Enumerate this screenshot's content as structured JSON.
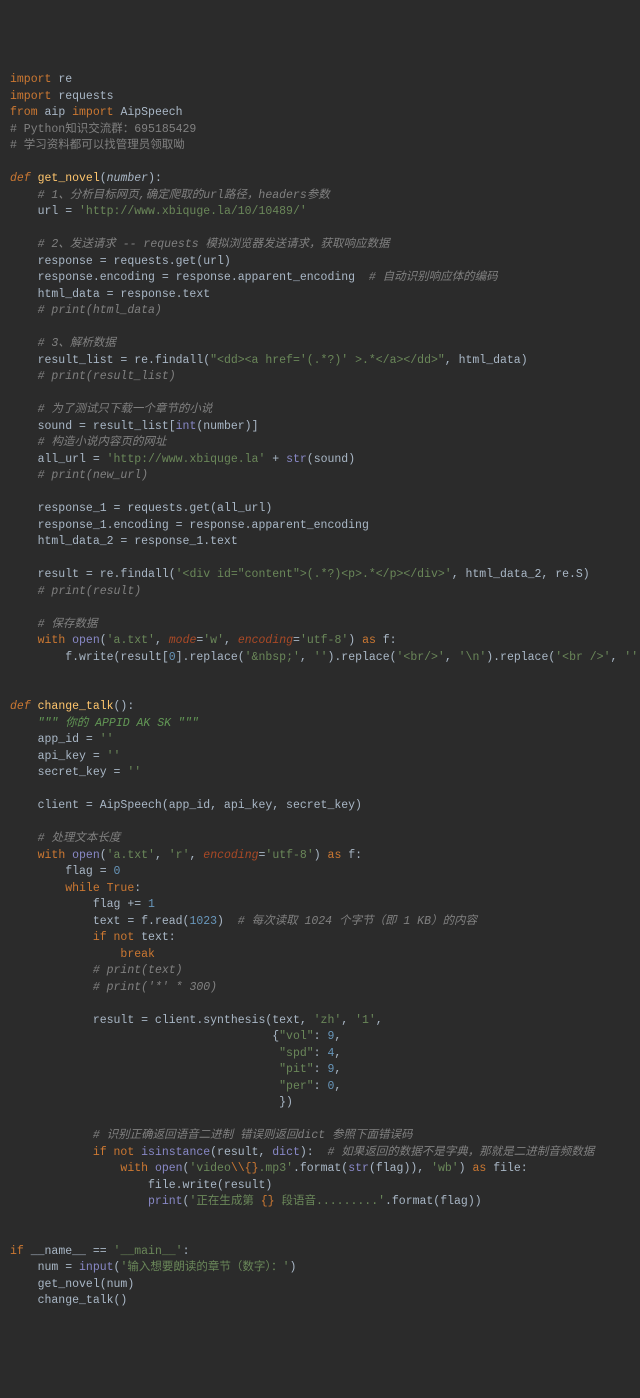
{
  "lines": [
    [
      [
        "kw",
        "import "
      ],
      [
        "op",
        "re"
      ]
    ],
    [
      [
        "kw",
        "import "
      ],
      [
        "op",
        "requests"
      ]
    ],
    [
      [
        "kw",
        "from "
      ],
      [
        "op",
        "aip "
      ],
      [
        "kw",
        "import "
      ],
      [
        "op",
        "AipSpeech"
      ]
    ],
    [
      [
        "cmt",
        "# Python知识交流群：695185429"
      ]
    ],
    [
      [
        "cmt",
        "# 学习资料都可以找管理员领取呦"
      ]
    ],
    [
      [
        "op",
        ""
      ]
    ],
    [
      [
        "kw kw-i",
        "def "
      ],
      [
        "fn",
        "get_novel"
      ],
      [
        "op",
        "("
      ],
      [
        "param",
        "number"
      ],
      [
        "op",
        "):"
      ]
    ],
    [
      [
        "op",
        "    "
      ],
      [
        "cmt cmt-i",
        "# 1、分析目标网页,确定爬取的url路径，headers参数"
      ]
    ],
    [
      [
        "op",
        "    url = "
      ],
      [
        "str",
        "'http://www.xbiquge.la/10/10489/'"
      ]
    ],
    [
      [
        "op",
        ""
      ]
    ],
    [
      [
        "op",
        "    "
      ],
      [
        "cmt cmt-i",
        "# 2、发送请求 -- requests 模拟浏览器发送请求，获取响应数据"
      ]
    ],
    [
      [
        "op",
        "    response = requests.get(url)"
      ]
    ],
    [
      [
        "op",
        "    response.encoding = response.apparent_encoding  "
      ],
      [
        "cmt cmt-i",
        "# 自动识别响应体的编码"
      ]
    ],
    [
      [
        "op",
        "    html_data = response.text"
      ]
    ],
    [
      [
        "op",
        "    "
      ],
      [
        "cmt cmt-i",
        "# print(html_data)"
      ]
    ],
    [
      [
        "op",
        ""
      ]
    ],
    [
      [
        "op",
        "    "
      ],
      [
        "cmt cmt-i",
        "# 3、解析数据"
      ]
    ],
    [
      [
        "op",
        "    result_list = re.findall("
      ],
      [
        "str",
        "\"<dd><a href='(.*?)' >.*</a></dd>\""
      ],
      [
        "op",
        ", html_data)"
      ]
    ],
    [
      [
        "op",
        "    "
      ],
      [
        "cmt cmt-i",
        "# print(result_list)"
      ]
    ],
    [
      [
        "op",
        ""
      ]
    ],
    [
      [
        "op",
        "    "
      ],
      [
        "cmt cmt-i",
        "# 为了测试只下载一个章节的小说"
      ]
    ],
    [
      [
        "op",
        "    sound = result_list["
      ],
      [
        "built",
        "int"
      ],
      [
        "op",
        "(number)]"
      ]
    ],
    [
      [
        "op",
        "    "
      ],
      [
        "cmt cmt-i",
        "# 构造小说内容页的网址"
      ]
    ],
    [
      [
        "op",
        "    all_url = "
      ],
      [
        "str",
        "'http://www.xbiquge.la'"
      ],
      [
        "op",
        " + "
      ],
      [
        "built",
        "str"
      ],
      [
        "op",
        "(sound)"
      ]
    ],
    [
      [
        "op",
        "    "
      ],
      [
        "cmt cmt-i",
        "# print(new_url)"
      ]
    ],
    [
      [
        "op",
        ""
      ]
    ],
    [
      [
        "op",
        "    response_1 = requests.get(all_url)"
      ]
    ],
    [
      [
        "op",
        "    response_1.encoding = response.apparent_encoding"
      ]
    ],
    [
      [
        "op",
        "    html_data_2 = response_1.text"
      ]
    ],
    [
      [
        "op",
        ""
      ]
    ],
    [
      [
        "op",
        "    result = re.findall("
      ],
      [
        "str",
        "'<div id=\"content\">(.*?)<p>.*</p></div>'"
      ],
      [
        "op",
        ", html_data_2, re.S)"
      ]
    ],
    [
      [
        "op",
        "    "
      ],
      [
        "cmt cmt-i",
        "# print(result)"
      ]
    ],
    [
      [
        "op",
        ""
      ]
    ],
    [
      [
        "op",
        "    "
      ],
      [
        "cmt cmt-i",
        "# 保存数据"
      ]
    ],
    [
      [
        "op",
        "    "
      ],
      [
        "kw",
        "with "
      ],
      [
        "built",
        "open"
      ],
      [
        "op",
        "("
      ],
      [
        "str",
        "'a.txt'"
      ],
      [
        "op",
        ", "
      ],
      [
        "named",
        "mode"
      ],
      [
        "op",
        "="
      ],
      [
        "str",
        "'w'"
      ],
      [
        "op",
        ", "
      ],
      [
        "named",
        "encoding"
      ],
      [
        "op",
        "="
      ],
      [
        "str",
        "'utf-8'"
      ],
      [
        "op",
        ") "
      ],
      [
        "kw",
        "as "
      ],
      [
        "op",
        "f:"
      ]
    ],
    [
      [
        "op",
        "        f.write(result["
      ],
      [
        "num",
        "0"
      ],
      [
        "op",
        "].replace("
      ],
      [
        "str",
        "'&nbsp;'"
      ],
      [
        "op",
        ", "
      ],
      [
        "str",
        "''"
      ],
      [
        "op",
        ").replace("
      ],
      [
        "str",
        "'<br/>'"
      ],
      [
        "op",
        ", "
      ],
      [
        "str",
        "'\\n'"
      ],
      [
        "op",
        ").replace("
      ],
      [
        "str",
        "'<br />'"
      ],
      [
        "op",
        ", "
      ],
      [
        "str",
        "''"
      ],
      [
        "op",
        "))"
      ]
    ],
    [
      [
        "op",
        ""
      ]
    ],
    [
      [
        "op",
        ""
      ]
    ],
    [
      [
        "kw kw-i",
        "def "
      ],
      [
        "fn",
        "change_talk"
      ],
      [
        "op",
        "():"
      ]
    ],
    [
      [
        "op",
        "    "
      ],
      [
        "doc",
        "\"\"\" 你的 APPID AK SK \"\"\""
      ]
    ],
    [
      [
        "op",
        "    app_id = "
      ],
      [
        "str",
        "''"
      ]
    ],
    [
      [
        "op",
        "    api_key = "
      ],
      [
        "str",
        "''"
      ]
    ],
    [
      [
        "op",
        "    secret_key = "
      ],
      [
        "str",
        "''"
      ]
    ],
    [
      [
        "op",
        ""
      ]
    ],
    [
      [
        "op",
        "    client = AipSpeech(app_id, api_key, secret_key)"
      ]
    ],
    [
      [
        "op",
        ""
      ]
    ],
    [
      [
        "op",
        "    "
      ],
      [
        "cmt cmt-i",
        "# 处理文本长度"
      ]
    ],
    [
      [
        "op",
        "    "
      ],
      [
        "kw",
        "with "
      ],
      [
        "built",
        "open"
      ],
      [
        "op",
        "("
      ],
      [
        "str",
        "'a.txt'"
      ],
      [
        "op",
        ", "
      ],
      [
        "str",
        "'r'"
      ],
      [
        "op",
        ", "
      ],
      [
        "named",
        "encoding"
      ],
      [
        "op",
        "="
      ],
      [
        "str",
        "'utf-8'"
      ],
      [
        "op",
        ") "
      ],
      [
        "kw",
        "as "
      ],
      [
        "op",
        "f:"
      ]
    ],
    [
      [
        "op",
        "        flag = "
      ],
      [
        "num",
        "0"
      ]
    ],
    [
      [
        "op",
        "        "
      ],
      [
        "kw",
        "while True"
      ],
      [
        "op",
        ":"
      ]
    ],
    [
      [
        "op",
        "            flag += "
      ],
      [
        "num",
        "1"
      ]
    ],
    [
      [
        "op",
        "            text = f.read("
      ],
      [
        "num",
        "1023"
      ],
      [
        "op",
        ")  "
      ],
      [
        "cmt cmt-i",
        "# 每次读取 1024 个字节（即 1 KB）的内容"
      ]
    ],
    [
      [
        "op",
        "            "
      ],
      [
        "kw",
        "if not "
      ],
      [
        "op",
        "text:"
      ]
    ],
    [
      [
        "op",
        "                "
      ],
      [
        "kw",
        "break"
      ]
    ],
    [
      [
        "op",
        "            "
      ],
      [
        "cmt cmt-i",
        "# print(text)"
      ]
    ],
    [
      [
        "op",
        "            "
      ],
      [
        "cmt cmt-i",
        "# print('*' * 300)"
      ]
    ],
    [
      [
        "op",
        ""
      ]
    ],
    [
      [
        "op",
        "            result = client.synthesis(text, "
      ],
      [
        "str",
        "'zh'"
      ],
      [
        "op",
        ", "
      ],
      [
        "str",
        "'1'"
      ],
      [
        "op",
        ","
      ]
    ],
    [
      [
        "op",
        "                                      {"
      ],
      [
        "str",
        "\"vol\""
      ],
      [
        "op",
        ": "
      ],
      [
        "num",
        "9"
      ],
      [
        "op",
        ","
      ]
    ],
    [
      [
        "op",
        "                                       "
      ],
      [
        "str",
        "\"spd\""
      ],
      [
        "op",
        ": "
      ],
      [
        "num",
        "4"
      ],
      [
        "op",
        ","
      ]
    ],
    [
      [
        "op",
        "                                       "
      ],
      [
        "str",
        "\"pit\""
      ],
      [
        "op",
        ": "
      ],
      [
        "num",
        "9"
      ],
      [
        "op",
        ","
      ]
    ],
    [
      [
        "op",
        "                                       "
      ],
      [
        "str",
        "\"per\""
      ],
      [
        "op",
        ": "
      ],
      [
        "num",
        "0"
      ],
      [
        "op",
        ","
      ]
    ],
    [
      [
        "op",
        "                                       })"
      ]
    ],
    [
      [
        "op",
        ""
      ]
    ],
    [
      [
        "op",
        "            "
      ],
      [
        "cmt cmt-i",
        "# 识别正确返回语音二进制 错误则返回dict 参照下面错误码"
      ]
    ],
    [
      [
        "op",
        "            "
      ],
      [
        "kw",
        "if not "
      ],
      [
        "built",
        "isinstance"
      ],
      [
        "op",
        "(result, "
      ],
      [
        "built",
        "dict"
      ],
      [
        "op",
        "):  "
      ],
      [
        "cmt cmt-i",
        "# 如果返回的数据不是字典，那就是二进制音频数据"
      ]
    ],
    [
      [
        "op",
        "                "
      ],
      [
        "kw",
        "with "
      ],
      [
        "built",
        "open"
      ],
      [
        "op",
        "("
      ],
      [
        "str",
        "'video"
      ],
      [
        "kw",
        "\\\\{}"
      ],
      [
        "str",
        ".mp3'"
      ],
      [
        "op",
        ".format("
      ],
      [
        "built",
        "str"
      ],
      [
        "op",
        "(flag)), "
      ],
      [
        "str",
        "'wb'"
      ],
      [
        "op",
        ") "
      ],
      [
        "kw",
        "as "
      ],
      [
        "op",
        "file:"
      ]
    ],
    [
      [
        "op",
        "                    file.write(result)"
      ]
    ],
    [
      [
        "op",
        "                    "
      ],
      [
        "built",
        "print"
      ],
      [
        "op",
        "("
      ],
      [
        "str",
        "'正在生成第 "
      ],
      [
        "kw",
        "{}"
      ],
      [
        "str",
        " 段语音.........'"
      ],
      [
        "op",
        ".format(flag))"
      ]
    ],
    [
      [
        "op",
        ""
      ]
    ],
    [
      [
        "op",
        ""
      ]
    ],
    [
      [
        "kw",
        "if "
      ],
      [
        "op",
        "__name__ == "
      ],
      [
        "str",
        "'__main__'"
      ],
      [
        "op",
        ":"
      ]
    ],
    [
      [
        "op",
        "    num = "
      ],
      [
        "built",
        "input"
      ],
      [
        "op",
        "("
      ],
      [
        "str",
        "'输入想要朗读的章节（数字）：'"
      ],
      [
        "op",
        ")"
      ]
    ],
    [
      [
        "op",
        "    get_novel(num)"
      ]
    ],
    [
      [
        "op",
        "    change_talk()"
      ]
    ]
  ]
}
